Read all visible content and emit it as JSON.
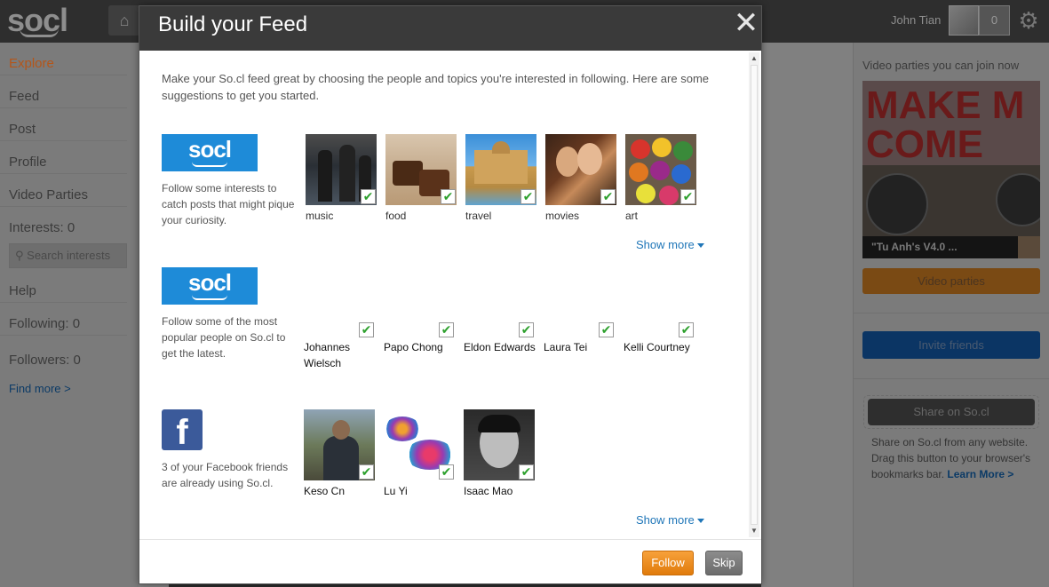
{
  "topbar": {
    "logo_text": "socl",
    "user_name": "John Tian",
    "notification_count": "0"
  },
  "leftnav": {
    "items": [
      {
        "label": "Explore"
      },
      {
        "label": "Feed"
      },
      {
        "label": "Post"
      },
      {
        "label": "Profile"
      },
      {
        "label": "Video Parties"
      },
      {
        "label": "Interests: 0"
      }
    ],
    "search_placeholder": "Search interests",
    "items2": [
      {
        "label": "Help"
      },
      {
        "label": "Following: 0"
      },
      {
        "label": "Followers: 0"
      }
    ],
    "find_more": "Find more >"
  },
  "rightcol": {
    "video_parties_title": "Video parties you can join now",
    "video_thumb_text": "MAKE M COME ALI",
    "video_caption": "\"Tu Anh's V4.0 ...",
    "video_parties_button": "Video parties",
    "invite_button": "Invite friends",
    "share_button": "Share on So.cl",
    "share_desc": "Share on So.cl from any website. Drag this button to your browser's bookmarks bar.",
    "learn_more": "Learn More >"
  },
  "modal": {
    "title": "Build your Feed",
    "close_icon": "close-icon",
    "intro": "Make your So.cl feed great by choosing the people and topics you're interested in following. Here are some suggestions to get you started.",
    "interests_section": {
      "logo_text": "socl",
      "desc": "Follow some interests to catch posts that might pique your curiosity.",
      "items": [
        {
          "label": "music",
          "checked": true
        },
        {
          "label": "food",
          "checked": true
        },
        {
          "label": "travel",
          "checked": true
        },
        {
          "label": "movies",
          "checked": true
        },
        {
          "label": "art",
          "checked": true
        }
      ],
      "show_more": "Show more"
    },
    "people_section": {
      "logo_text": "socl",
      "desc": "Follow some of the most popular people on So.cl to get the latest.",
      "items": [
        {
          "label": "Johannes Wielsch",
          "checked": true
        },
        {
          "label": "Papo Chong",
          "checked": true
        },
        {
          "label": "Eldon Edwards",
          "checked": true
        },
        {
          "label": "Laura Tei",
          "checked": true
        },
        {
          "label": "Kelli Courtney",
          "checked": true
        }
      ]
    },
    "facebook_section": {
      "logo_text": "f",
      "desc": "3 of your Facebook friends are already using So.cl.",
      "items": [
        {
          "label": "Keso Cn",
          "checked": true
        },
        {
          "label": "Lu Yi",
          "checked": true
        },
        {
          "label": "Isaac Mao",
          "checked": true
        }
      ],
      "show_more": "Show more"
    },
    "check_glyph": "✔",
    "follow_button": "Follow",
    "skip_button": "Skip"
  }
}
